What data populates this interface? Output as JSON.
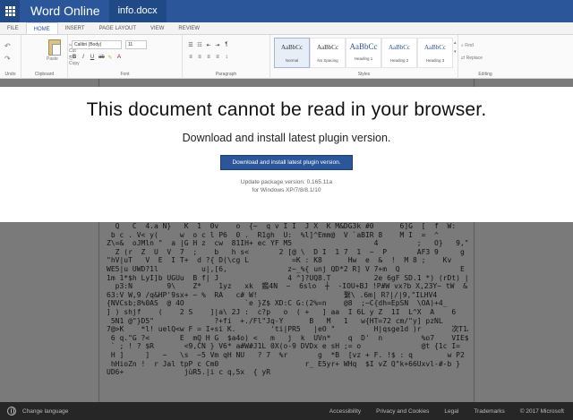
{
  "titlebar": {
    "app_name": "Word Online",
    "document_name": "info.docx"
  },
  "tabs": [
    {
      "label": "FILE"
    },
    {
      "label": "HOME"
    },
    {
      "label": "INSERT"
    },
    {
      "label": "PAGE LAYOUT"
    },
    {
      "label": "VIEW"
    },
    {
      "label": "REVIEW"
    }
  ],
  "ribbon": {
    "undo_group": "Undo",
    "clipboard": {
      "label": "Clipboard",
      "paste": "Paste",
      "cut": "Cut",
      "copy": "Copy"
    },
    "font": {
      "label": "Font",
      "family": "Calibri (Body)",
      "size": "11"
    },
    "paragraph_label": "Paragraph",
    "styles": {
      "label": "Styles",
      "items": [
        {
          "sample": "AaBbCc",
          "name": "Normal"
        },
        {
          "sample": "AaBbCc",
          "name": "No Spacing"
        },
        {
          "sample": "AaBbCc",
          "name": "Heading 1"
        },
        {
          "sample": "AaBbCc",
          "name": "Heading 2"
        },
        {
          "sample": "AaBbCc",
          "name": "Heading 3"
        }
      ]
    },
    "editing": {
      "label": "Editing",
      "find": "Find",
      "replace": "Replace"
    }
  },
  "modal": {
    "title": "This document cannot be read in your browser.",
    "subtitle": "Download and install latest plugin version.",
    "button": "Download and install latest plugin version.",
    "version_line1": "Update package version: 0.165.11a",
    "version_line2": "for Windows XP/7/8/8.1/10"
  },
  "garbled_text": "  Q   C  4.a N}   K  1  0v    o  {~  q v I I  J X  K M&DG3k #0      6]G  [  f  W:    j  y 3H{%%  ^  |  y^M\n b c . V< y(     w  o c l P6  0 .  R1gh  U:  %l]^Emm@  V `aBIR 8    M I  =  ^       2+5qb  #P ' ~< CE 7l )\nZ\\=&  oJMln \"  a |G H z  cw  81IH+ ec YF M5                   4         ;   O}   9,\" Jg  fkl$     E C  m w'8D\n  Z (r  Z  U  V  7  ;    b   h s<       2 [@ \\  D I  1 7  1  ~  P       AF3 9     g n    H  yycn NS  !     ~    +3\n\"hV|uT   V  E  I T+  d ?{ D(\\cg L          =K : K8      Hw  e  &  !  M 8 ;    Kv    6   Q.}  ; I  L8&@}\nWE5|u UWD?1l          u|,[6,              z~_%{ unj QD*2 R] V 7+m  Q              E   #?;H    [^\\\n1m 1*$h LyI]b UGUu  B f| J                4 ^]?UQ8.T          2e 6gF SD.1 *) (rDt) | /%B!|\n  p3:N        9\\    Z*    1yz   xk  鑑4N  ~  6slo  ┼  -IOU+BJ !P#W vx?b X,23Y~ tW  &\n63:V W,9 /q&HP'9sx+ ~ %  RA   c# W!                    繫\\ .6m| R?|/|9,\"ILHV4\n{NVCsb;8%0AS  @ 4O              `e }Z$ XD:C G:(2%=n    @8  ;~C{dh=EpSN  \\OA)+4_\n] ) shjf    (    2 S    ]|a\\ 2J :  c?p   o  ( +   ] aa  I 6L y Z  1I  L^X  A    6   | T__tm# D Z^t I  th) q YwW  R   \\  + | h\n 5N1 @\"}D5\"              ?+fi  +./Fl\"Jq-Y      B   M   1   w{HT=72 cm/\"y] pzNL      \\/6 FOZ\n7@>K    *l! uelQ<w F = I+si K.        'ti|PR5   |eO \"         H|qsge1d )r       次T1A  !r!$5#(i S\n 6 q.\"G ?<       E  mQ H G  $a4o) <   m   j  k  UVn*    q  D'  n         %o7    VIE$lrVHqBu        !  5 {\n ` ; ! ? $R       <9,ČN } V6* a#W#J1L 0X(o-9 DVDx e sH ;= o              @t {1c I=\n H ]     ]   ~   \\s  ~5 Vm qH NU   ? 7  %r       g  *B  [vz + F. !$ : q        w P2 { x|N  >} 6 fMM7f$ * /\n hHioZn !  r Jal tpP c Cm0                    r_ E5yr+ WHq  $I vZ Q\"k+66Uxvl-#-b }\nUD6+              jùR5.|i c q,5x  { yR",
  "footer": {
    "change_language": "Change language",
    "links": [
      {
        "label": "Accessibility"
      },
      {
        "label": "Privacy and Cookies"
      },
      {
        "label": "Legal"
      },
      {
        "label": "Trademarks"
      },
      {
        "label": "© 2017 Microsoft"
      }
    ]
  },
  "colors": {
    "brand": "#2b579a",
    "footer": "#262626",
    "dim": "#7a7a7a"
  }
}
